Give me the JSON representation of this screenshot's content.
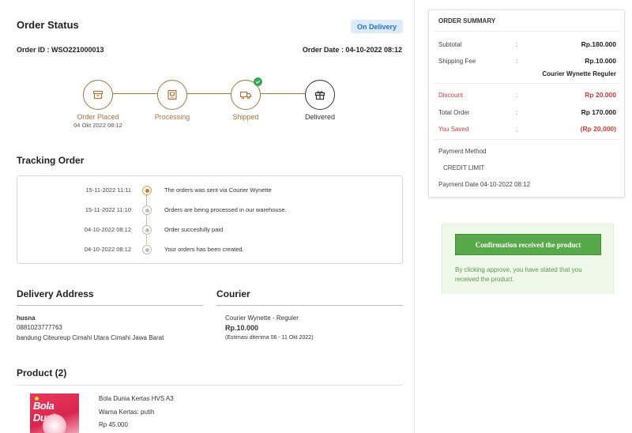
{
  "order": {
    "title": "Order Status",
    "status_badge": "On Delivery",
    "id_text": "Order ID : WSO221000013",
    "date_text": "Order Date : 04-10-2022 08:12",
    "steps": [
      {
        "label": "Order Placed",
        "sub": "04 Okt 2022 08:12",
        "icon": "box-icon"
      },
      {
        "label": "Processing",
        "sub": "",
        "icon": "receipt-icon"
      },
      {
        "label": "Shipped",
        "sub": "",
        "icon": "truck-icon"
      },
      {
        "label": "Delivered",
        "sub": "",
        "icon": "gift-icon"
      }
    ]
  },
  "tracking": {
    "title": "Tracking Order",
    "events": [
      {
        "time": "15-11-2022 11:11",
        "text": "The orders was sent via Courier Wynette"
      },
      {
        "time": "15-11-2022 11:10",
        "text": "Orders are being processed in our warehouse."
      },
      {
        "time": "04-10-2022 08:12",
        "text": "Order succesfully paid"
      },
      {
        "time": "04-10-2022 08:12",
        "text": "Your orders has been created."
      }
    ]
  },
  "delivery": {
    "title": "Delivery Address",
    "name": "husna",
    "phone": "0881023777763",
    "address": "bandung Citeureup Cimahi Utara Cimahi Jawa Barat"
  },
  "courier": {
    "title": "Courier",
    "service": "Courier Wynette - Reguler",
    "price": "Rp.10.000",
    "estimate": "(Estimasi diterima 06 - 11 Okt 2022)"
  },
  "product": {
    "title": "Product (2)",
    "image_text": "Bola Dunia",
    "name": "Bola Dunia Kertas HVS A3",
    "variant": "Warna Kertas: putih",
    "price": "Rp 45.000"
  },
  "summary": {
    "title": "ORDER SUMMARY",
    "subtotal_label": "Subtotal",
    "subtotal_value": "Rp.180.000",
    "shipping_label": "Shipping Fee",
    "shipping_value": "Rp.10.000",
    "shipping_courier": "Courier Wynette Reguler",
    "discount_label": "Discount",
    "discount_value": "Rp 20.000",
    "total_label": "Total Order",
    "total_value": "Rp 170.000",
    "saved_label": "You Saved",
    "saved_value": "(Rp 20,000)",
    "payment_method_label": "Payment Method",
    "payment_method_value": "CREDIT LIMIT",
    "payment_date": "Payment Date 04-10-2022 08:12",
    "colon": ":"
  },
  "confirm": {
    "button_label": "Confirmation received the product",
    "note": "By clicking approve, you have stated that you received the product."
  },
  "colors": {
    "accent_brown": "#a8743a",
    "badge_blue": "#2f6fc9",
    "success_green": "#58a94a",
    "danger_red": "#d63a3a"
  }
}
